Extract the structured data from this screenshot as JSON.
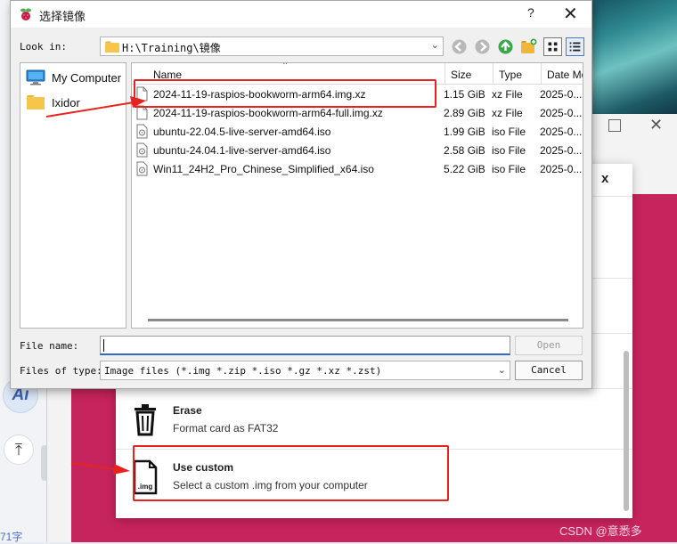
{
  "background_page": {
    "ai_label": "Ai",
    "back_to_top": "⤒",
    "word_count": "71字"
  },
  "imager": {
    "dialog_close": "x",
    "options": [
      {
        "icon": "trash-icon",
        "title": "Erase",
        "desc": "Format card as FAT32"
      },
      {
        "icon": "img-file-icon",
        "title": "Use custom",
        "desc": "Select a custom .img from your computer",
        "icon_text": ".img"
      }
    ],
    "watermark": "CSDN @意悉多"
  },
  "file_dialog": {
    "title": "选择镜像",
    "help": "?",
    "close": "✕",
    "look_in_label": "Look in:",
    "path": "H:\\Training\\镜像",
    "sidebar": [
      {
        "label": "My Computer",
        "icon": "computer-icon"
      },
      {
        "label": "Ixidor",
        "icon": "folder-icon"
      }
    ],
    "columns": [
      "Name",
      "Size",
      "Type",
      "Date Mo"
    ],
    "files": [
      {
        "name": "2024-11-19-raspios-bookworm-arm64.img.xz",
        "size": "1.15 GiB",
        "type": "xz File",
        "date": "2025-0..."
      },
      {
        "name": "2024-11-19-raspios-bookworm-arm64-full.img.xz",
        "size": "2.89 GiB",
        "type": "xz File",
        "date": "2025-0..."
      },
      {
        "name": "ubuntu-22.04.5-live-server-amd64.iso",
        "size": "1.99 GiB",
        "type": "iso File",
        "date": "2025-0..."
      },
      {
        "name": "ubuntu-24.04.1-live-server-amd64.iso",
        "size": "2.58 GiB",
        "type": "iso File",
        "date": "2025-0..."
      },
      {
        "name": "Win11_24H2_Pro_Chinese_Simplified_x64.iso",
        "size": "5.22 GiB",
        "type": "iso File",
        "date": "2025-0..."
      }
    ],
    "file_name_label": "File name:",
    "file_name_value": "",
    "open_label": "Open",
    "file_type_label": "Files of type:",
    "file_type_value": "Image files (*.img *.zip *.iso *.gz *.xz *.zst)",
    "cancel_label": "Cancel"
  },
  "colors": {
    "annotation_red": "#e8231f",
    "imager_pink": "#c6245c",
    "focus_blue": "#2d6ac9"
  }
}
